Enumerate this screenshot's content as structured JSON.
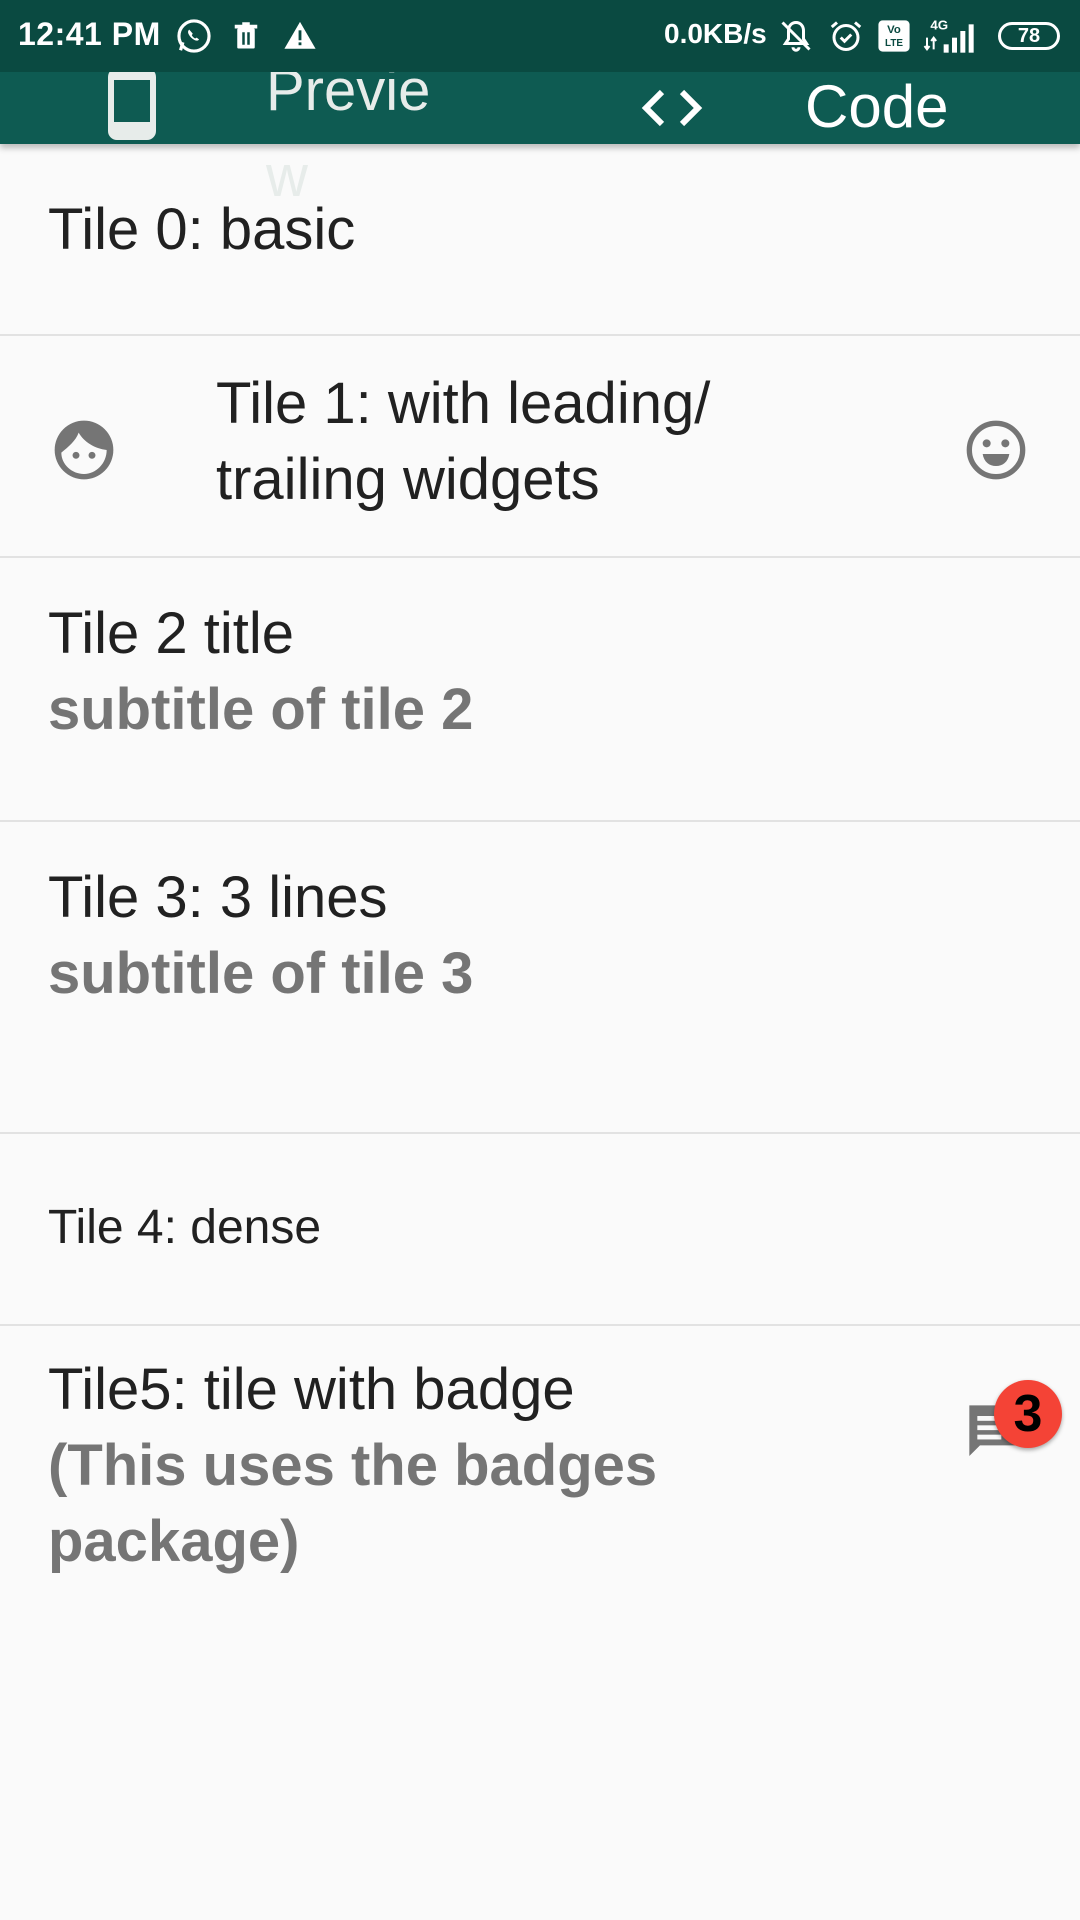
{
  "status_bar": {
    "time": "12:41 PM",
    "net_speed": "0.0KB/s",
    "battery": "78",
    "network_label": "4G",
    "volte_label": "Vo LTE",
    "icons": [
      "whatsapp-icon",
      "trash-icon",
      "warning-icon",
      "notifications-off-icon",
      "alarm-icon",
      "volte-icon",
      "signal-icon",
      "battery-icon"
    ]
  },
  "app_bar": {
    "preview_tab": "Preview",
    "code_tab": "Code",
    "colors": {
      "status": "#0a4a41",
      "bar": "#0e5b52"
    }
  },
  "tiles": [
    {
      "title": "Tile 0: basic"
    },
    {
      "title": "Tile 1: with leading/ trailing widgets",
      "leading_icon": "face-icon",
      "trailing_icon": "sentiment-satisfied-icon"
    },
    {
      "title": "Tile 2 title",
      "subtitle": "subtitle of tile 2"
    },
    {
      "title": "Tile 3: 3 lines",
      "subtitle": "subtitle of tile 3"
    },
    {
      "title": "Tile 4: dense"
    },
    {
      "title": "Tile5: tile with badge",
      "subtitle": "(This uses the badges package)",
      "trailing_icon": "chat-icon",
      "badge_count": "3",
      "badge_color": "#f44336"
    }
  ]
}
